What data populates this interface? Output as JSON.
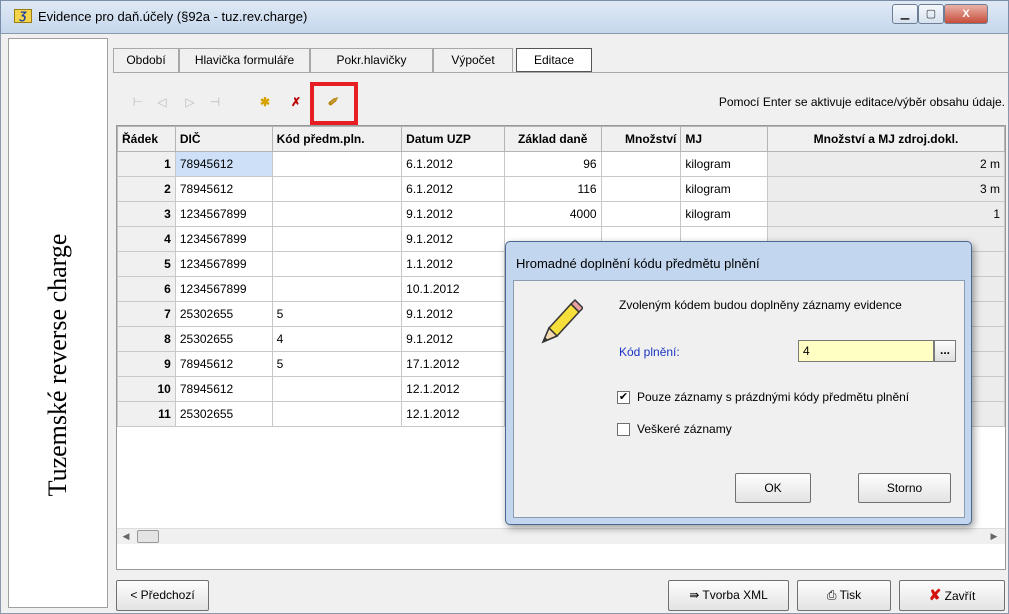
{
  "window": {
    "title": "Evidence pro daň.účely (§92a - tuz.rev.charge)",
    "icon_glyph": "Ʒ",
    "controls": {
      "minimize": "▁",
      "maximize": "▢",
      "close": "X"
    }
  },
  "sidebar": {
    "banner_text": "Tuzemské reverse charge"
  },
  "tabs": [
    {
      "label": "Období",
      "active": false
    },
    {
      "label": "Hlavička formuláře",
      "active": false
    },
    {
      "label": "Pokr.hlavičky",
      "active": false
    },
    {
      "label": "Výpočet",
      "active": false
    },
    {
      "label": "Editace",
      "active": true
    }
  ],
  "toolbar": {
    "first_icon": "first-record-icon",
    "prev_icon": "prev-record-icon",
    "next_icon": "next-record-icon",
    "last_icon": "last-record-icon",
    "new_icon": "new-record-icon",
    "delete_icon": "delete-record-icon",
    "bulk_fill_icon": "bulk-fill-icon",
    "first_glyph": "⊢",
    "prev_glyph": "◁",
    "next_glyph": "▷",
    "last_glyph": "⊣",
    "new_glyph": "✱",
    "delete_glyph": "✗",
    "fill_glyph": "✐",
    "hint": "Pomocí Enter se aktivuje editace/výběr obsahu údaje."
  },
  "grid": {
    "columns": [
      "Řádek",
      "DIČ",
      "Kód předm.pln.",
      "Datum UZP",
      "Základ daně",
      "Množství",
      "MJ",
      "Množství a MJ zdroj.dokl."
    ],
    "rows": [
      {
        "radek": "1",
        "dic": "78945612",
        "kod": "",
        "datum": "6.1.2012",
        "zaklad": "96",
        "mnozstvi": "",
        "mj": "kilogram",
        "zdroj": "2 m"
      },
      {
        "radek": "2",
        "dic": "78945612",
        "kod": "",
        "datum": "6.1.2012",
        "zaklad": "116",
        "mnozstvi": "",
        "mj": "kilogram",
        "zdroj": "3 m"
      },
      {
        "radek": "3",
        "dic": "1234567899",
        "kod": "",
        "datum": "9.1.2012",
        "zaklad": "4000",
        "mnozstvi": "",
        "mj": "kilogram",
        "zdroj": "1"
      },
      {
        "radek": "4",
        "dic": "1234567899",
        "kod": "",
        "datum": "9.1.2012",
        "zaklad": "",
        "mnozstvi": "",
        "mj": "",
        "zdroj": ""
      },
      {
        "radek": "5",
        "dic": "1234567899",
        "kod": "",
        "datum": "1.1.2012",
        "zaklad": "",
        "mnozstvi": "",
        "mj": "",
        "zdroj": ""
      },
      {
        "radek": "6",
        "dic": "1234567899",
        "kod": "",
        "datum": "10.1.2012",
        "zaklad": "",
        "mnozstvi": "",
        "mj": "",
        "zdroj": ""
      },
      {
        "radek": "7",
        "dic": "25302655",
        "kod": "5",
        "datum": "9.1.2012",
        "zaklad": "",
        "mnozstvi": "",
        "mj": "",
        "zdroj": ""
      },
      {
        "radek": "8",
        "dic": "25302655",
        "kod": "4",
        "datum": "9.1.2012",
        "zaklad": "",
        "mnozstvi": "",
        "mj": "",
        "zdroj": ""
      },
      {
        "radek": "9",
        "dic": "78945612",
        "kod": "5",
        "datum": "17.1.2012",
        "zaklad": "",
        "mnozstvi": "",
        "mj": "",
        "zdroj": ""
      },
      {
        "radek": "10",
        "dic": "78945612",
        "kod": "",
        "datum": "12.1.2012",
        "zaklad": "",
        "mnozstvi": "",
        "mj": "",
        "zdroj": ""
      },
      {
        "radek": "11",
        "dic": "25302655",
        "kod": "",
        "datum": "12.1.2012",
        "zaklad": "",
        "mnozstvi": "",
        "mj": "",
        "zdroj": ""
      }
    ],
    "selected_cell": {
      "row": 1,
      "column": "DIČ"
    }
  },
  "footer": {
    "prev_label": "< Předchozí",
    "xml_label": "Tvorba XML",
    "print_label": "Tisk",
    "close_label": "Zavřít",
    "xml_icon": "export-xml-icon",
    "print_icon": "printer-icon",
    "close_icon": "red-x-icon",
    "xml_glyph": "⇛",
    "print_glyph": "⎙",
    "close_glyph": "✘"
  },
  "dialog": {
    "title": "Hromadné doplnění kódu předmětu plnění",
    "icon": "pencil-icon",
    "message": "Zvoleným kódem budou doplněny záznamy evidence",
    "kod_label": "Kód plnění:",
    "kod_value": "4",
    "kod_button": "...",
    "option_empty_only": {
      "label": "Pouze záznamy s prázdnými kódy předmětu plnění",
      "checked": true
    },
    "option_all": {
      "label": "Veškeré záznamy",
      "checked": false
    },
    "check_glyph": "✔",
    "ok_label": "OK",
    "cancel_label": "Storno"
  },
  "scroll": {
    "left_glyph": "◀",
    "right_glyph": "▶"
  },
  "colors": {
    "highlight": "#e81e25",
    "input_bg": "#ffffc4",
    "label_blue": "#1b35c4",
    "close_red": "#d3140e",
    "selection": "#cde0f7"
  }
}
